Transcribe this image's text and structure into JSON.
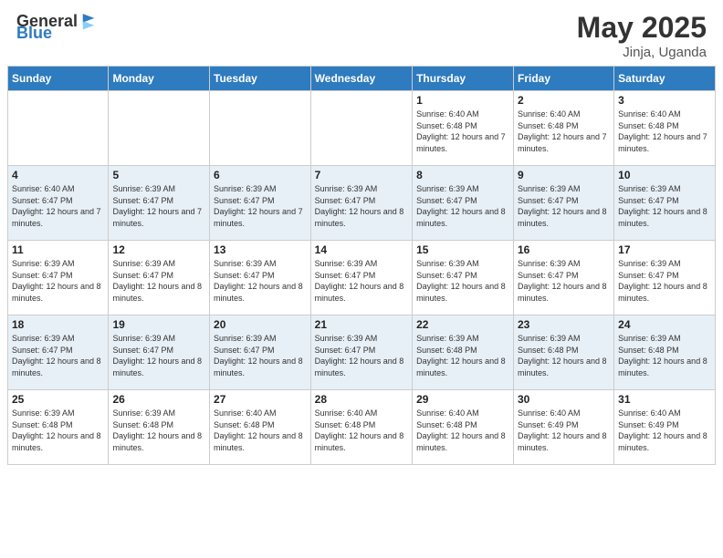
{
  "header": {
    "logo_general": "General",
    "logo_blue": "Blue",
    "title": "May 2025",
    "location": "Jinja, Uganda"
  },
  "weekdays": [
    "Sunday",
    "Monday",
    "Tuesday",
    "Wednesday",
    "Thursday",
    "Friday",
    "Saturday"
  ],
  "weeks": [
    [
      {
        "day": "",
        "info": ""
      },
      {
        "day": "",
        "info": ""
      },
      {
        "day": "",
        "info": ""
      },
      {
        "day": "",
        "info": ""
      },
      {
        "day": "1",
        "info": "Sunrise: 6:40 AM\nSunset: 6:48 PM\nDaylight: 12 hours and 7 minutes."
      },
      {
        "day": "2",
        "info": "Sunrise: 6:40 AM\nSunset: 6:48 PM\nDaylight: 12 hours and 7 minutes."
      },
      {
        "day": "3",
        "info": "Sunrise: 6:40 AM\nSunset: 6:48 PM\nDaylight: 12 hours and 7 minutes."
      }
    ],
    [
      {
        "day": "4",
        "info": "Sunrise: 6:40 AM\nSunset: 6:47 PM\nDaylight: 12 hours and 7 minutes."
      },
      {
        "day": "5",
        "info": "Sunrise: 6:39 AM\nSunset: 6:47 PM\nDaylight: 12 hours and 7 minutes."
      },
      {
        "day": "6",
        "info": "Sunrise: 6:39 AM\nSunset: 6:47 PM\nDaylight: 12 hours and 7 minutes."
      },
      {
        "day": "7",
        "info": "Sunrise: 6:39 AM\nSunset: 6:47 PM\nDaylight: 12 hours and 8 minutes."
      },
      {
        "day": "8",
        "info": "Sunrise: 6:39 AM\nSunset: 6:47 PM\nDaylight: 12 hours and 8 minutes."
      },
      {
        "day": "9",
        "info": "Sunrise: 6:39 AM\nSunset: 6:47 PM\nDaylight: 12 hours and 8 minutes."
      },
      {
        "day": "10",
        "info": "Sunrise: 6:39 AM\nSunset: 6:47 PM\nDaylight: 12 hours and 8 minutes."
      }
    ],
    [
      {
        "day": "11",
        "info": "Sunrise: 6:39 AM\nSunset: 6:47 PM\nDaylight: 12 hours and 8 minutes."
      },
      {
        "day": "12",
        "info": "Sunrise: 6:39 AM\nSunset: 6:47 PM\nDaylight: 12 hours and 8 minutes."
      },
      {
        "day": "13",
        "info": "Sunrise: 6:39 AM\nSunset: 6:47 PM\nDaylight: 12 hours and 8 minutes."
      },
      {
        "day": "14",
        "info": "Sunrise: 6:39 AM\nSunset: 6:47 PM\nDaylight: 12 hours and 8 minutes."
      },
      {
        "day": "15",
        "info": "Sunrise: 6:39 AM\nSunset: 6:47 PM\nDaylight: 12 hours and 8 minutes."
      },
      {
        "day": "16",
        "info": "Sunrise: 6:39 AM\nSunset: 6:47 PM\nDaylight: 12 hours and 8 minutes."
      },
      {
        "day": "17",
        "info": "Sunrise: 6:39 AM\nSunset: 6:47 PM\nDaylight: 12 hours and 8 minutes."
      }
    ],
    [
      {
        "day": "18",
        "info": "Sunrise: 6:39 AM\nSunset: 6:47 PM\nDaylight: 12 hours and 8 minutes."
      },
      {
        "day": "19",
        "info": "Sunrise: 6:39 AM\nSunset: 6:47 PM\nDaylight: 12 hours and 8 minutes."
      },
      {
        "day": "20",
        "info": "Sunrise: 6:39 AM\nSunset: 6:47 PM\nDaylight: 12 hours and 8 minutes."
      },
      {
        "day": "21",
        "info": "Sunrise: 6:39 AM\nSunset: 6:47 PM\nDaylight: 12 hours and 8 minutes."
      },
      {
        "day": "22",
        "info": "Sunrise: 6:39 AM\nSunset: 6:48 PM\nDaylight: 12 hours and 8 minutes."
      },
      {
        "day": "23",
        "info": "Sunrise: 6:39 AM\nSunset: 6:48 PM\nDaylight: 12 hours and 8 minutes."
      },
      {
        "day": "24",
        "info": "Sunrise: 6:39 AM\nSunset: 6:48 PM\nDaylight: 12 hours and 8 minutes."
      }
    ],
    [
      {
        "day": "25",
        "info": "Sunrise: 6:39 AM\nSunset: 6:48 PM\nDaylight: 12 hours and 8 minutes."
      },
      {
        "day": "26",
        "info": "Sunrise: 6:39 AM\nSunset: 6:48 PM\nDaylight: 12 hours and 8 minutes."
      },
      {
        "day": "27",
        "info": "Sunrise: 6:40 AM\nSunset: 6:48 PM\nDaylight: 12 hours and 8 minutes."
      },
      {
        "day": "28",
        "info": "Sunrise: 6:40 AM\nSunset: 6:48 PM\nDaylight: 12 hours and 8 minutes."
      },
      {
        "day": "29",
        "info": "Sunrise: 6:40 AM\nSunset: 6:48 PM\nDaylight: 12 hours and 8 minutes."
      },
      {
        "day": "30",
        "info": "Sunrise: 6:40 AM\nSunset: 6:49 PM\nDaylight: 12 hours and 8 minutes."
      },
      {
        "day": "31",
        "info": "Sunrise: 6:40 AM\nSunset: 6:49 PM\nDaylight: 12 hours and 8 minutes."
      }
    ]
  ]
}
